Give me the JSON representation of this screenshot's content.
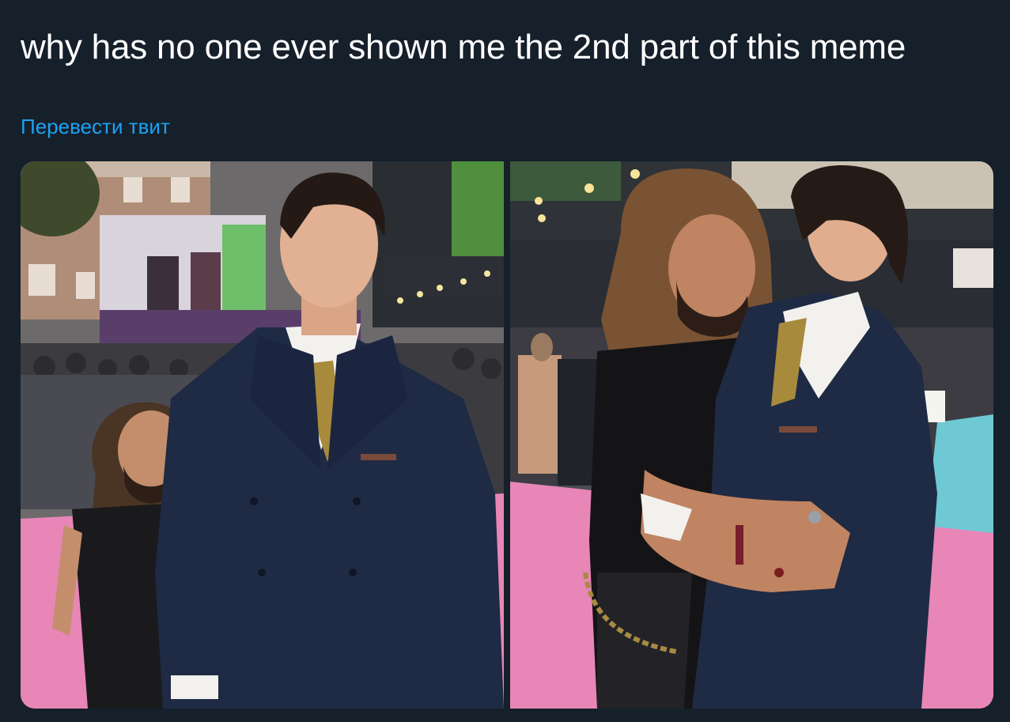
{
  "tweet": {
    "text": "why has no one ever shown me the 2nd part of this meme",
    "translate_label": "Перевести твит"
  },
  "colors": {
    "background": "#15202b",
    "text": "#ffffff",
    "link": "#1da1f2",
    "carpet": "#e886b8",
    "suit": "#1f2a44"
  },
  "media": {
    "images": [
      {
        "name": "photo-left"
      },
      {
        "name": "photo-right"
      }
    ]
  }
}
